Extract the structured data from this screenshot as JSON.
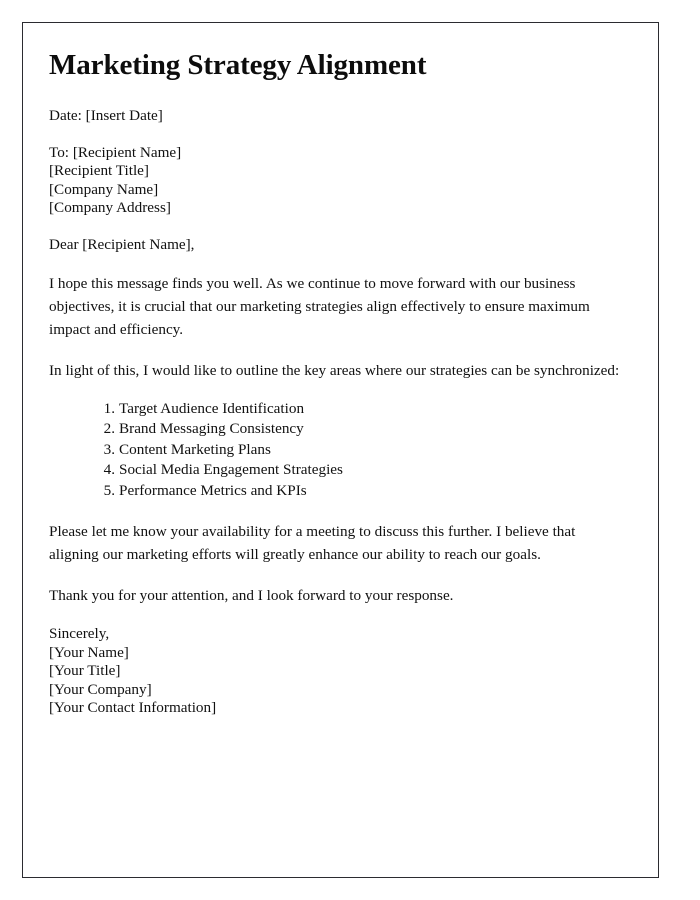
{
  "document": {
    "title": "Marketing Strategy Alignment",
    "date_line": "Date: [Insert Date]",
    "recipient_block": [
      "To: [Recipient Name]",
      "[Recipient Title]",
      "[Company Name]",
      "[Company Address]"
    ],
    "salutation": "Dear [Recipient Name],",
    "paragraph_1": "I hope this message finds you well. As we continue to move forward with our business objectives, it is crucial that our marketing strategies align effectively to ensure maximum impact and efficiency.",
    "paragraph_2": "In light of this, I would like to outline the key areas where our strategies can be synchronized:",
    "key_areas": [
      "Target Audience Identification",
      "Brand Messaging Consistency",
      "Content Marketing Plans",
      "Social Media Engagement Strategies",
      "Performance Metrics and KPIs"
    ],
    "paragraph_3": "Please let me know your availability for a meeting to discuss this further. I believe that aligning our marketing efforts will greatly enhance our ability to reach our goals.",
    "paragraph_4": "Thank you for your attention, and I look forward to your response.",
    "closing_block": [
      "Sincerely,",
      "[Your Name]",
      "[Your Title]",
      "[Your Company]",
      "[Your Contact Information]"
    ]
  },
  "style": {
    "text_color": "#111111",
    "border_color": "#2b2b30",
    "page_background": "#ffffff"
  }
}
